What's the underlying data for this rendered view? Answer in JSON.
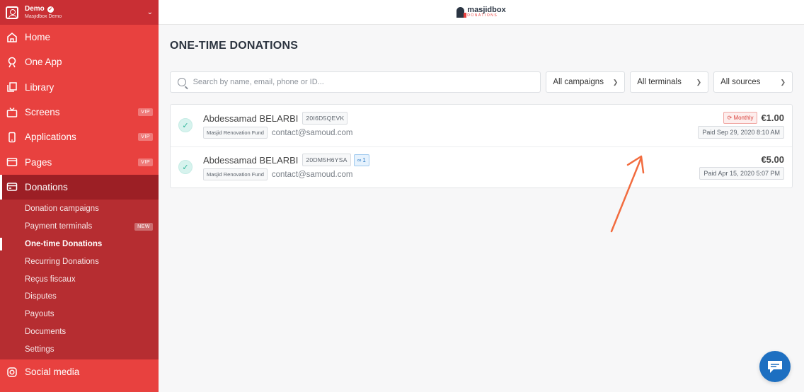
{
  "account": {
    "name": "Demo",
    "subtitle": "Masjidbox Demo"
  },
  "brand": {
    "name": "masjidbox",
    "tagline": "DONATIONS"
  },
  "sidebar": {
    "items": [
      {
        "label": "Home",
        "icon": "home-icon"
      },
      {
        "label": "One App",
        "icon": "app-icon"
      },
      {
        "label": "Library",
        "icon": "library-icon"
      },
      {
        "label": "Screens",
        "icon": "tv-icon",
        "badge": "VIP"
      },
      {
        "label": "Applications",
        "icon": "phone-icon",
        "badge": "VIP"
      },
      {
        "label": "Pages",
        "icon": "page-icon",
        "badge": "VIP"
      },
      {
        "label": "Donations",
        "icon": "card-icon",
        "active": true
      }
    ],
    "subitems": [
      {
        "label": "Donation campaigns"
      },
      {
        "label": "Payment terminals",
        "badge": "NEW"
      },
      {
        "label": "One-time Donations",
        "active": true
      },
      {
        "label": "Recurring Donations"
      },
      {
        "label": "Reçus fiscaux"
      },
      {
        "label": "Disputes"
      },
      {
        "label": "Payouts"
      },
      {
        "label": "Documents"
      },
      {
        "label": "Settings"
      }
    ],
    "after": {
      "label": "Social media",
      "icon": "instagram-icon"
    }
  },
  "page": {
    "title": "ONE-TIME DONATIONS"
  },
  "filters": {
    "search_placeholder": "Search by name, email, phone or ID...",
    "campaigns": "All campaigns",
    "terminals": "All terminals",
    "sources": "All sources"
  },
  "donations": [
    {
      "name": "Abdessamad BELARBI",
      "code": "20I6D5QEVK",
      "fund": "Masjid Renovation Fund",
      "email": "contact@samoud.com",
      "recurring": "Monthly",
      "amount": "€1.00",
      "paid": "Paid Sep 29, 2020 8:10 AM"
    },
    {
      "name": "Abdessamad BELARBI",
      "code": "20DM5H6YSA",
      "linked": "1",
      "fund": "Masjid Renovation Fund",
      "email": "contact@samoud.com",
      "amount": "€5.00",
      "paid": "Paid Apr 15, 2020 5:07 PM"
    }
  ],
  "colors": {
    "brand_red": "#e8413f",
    "active_dark": "#9c1f25",
    "arrow": "#f26c3f",
    "chat": "#1d6fc1"
  }
}
